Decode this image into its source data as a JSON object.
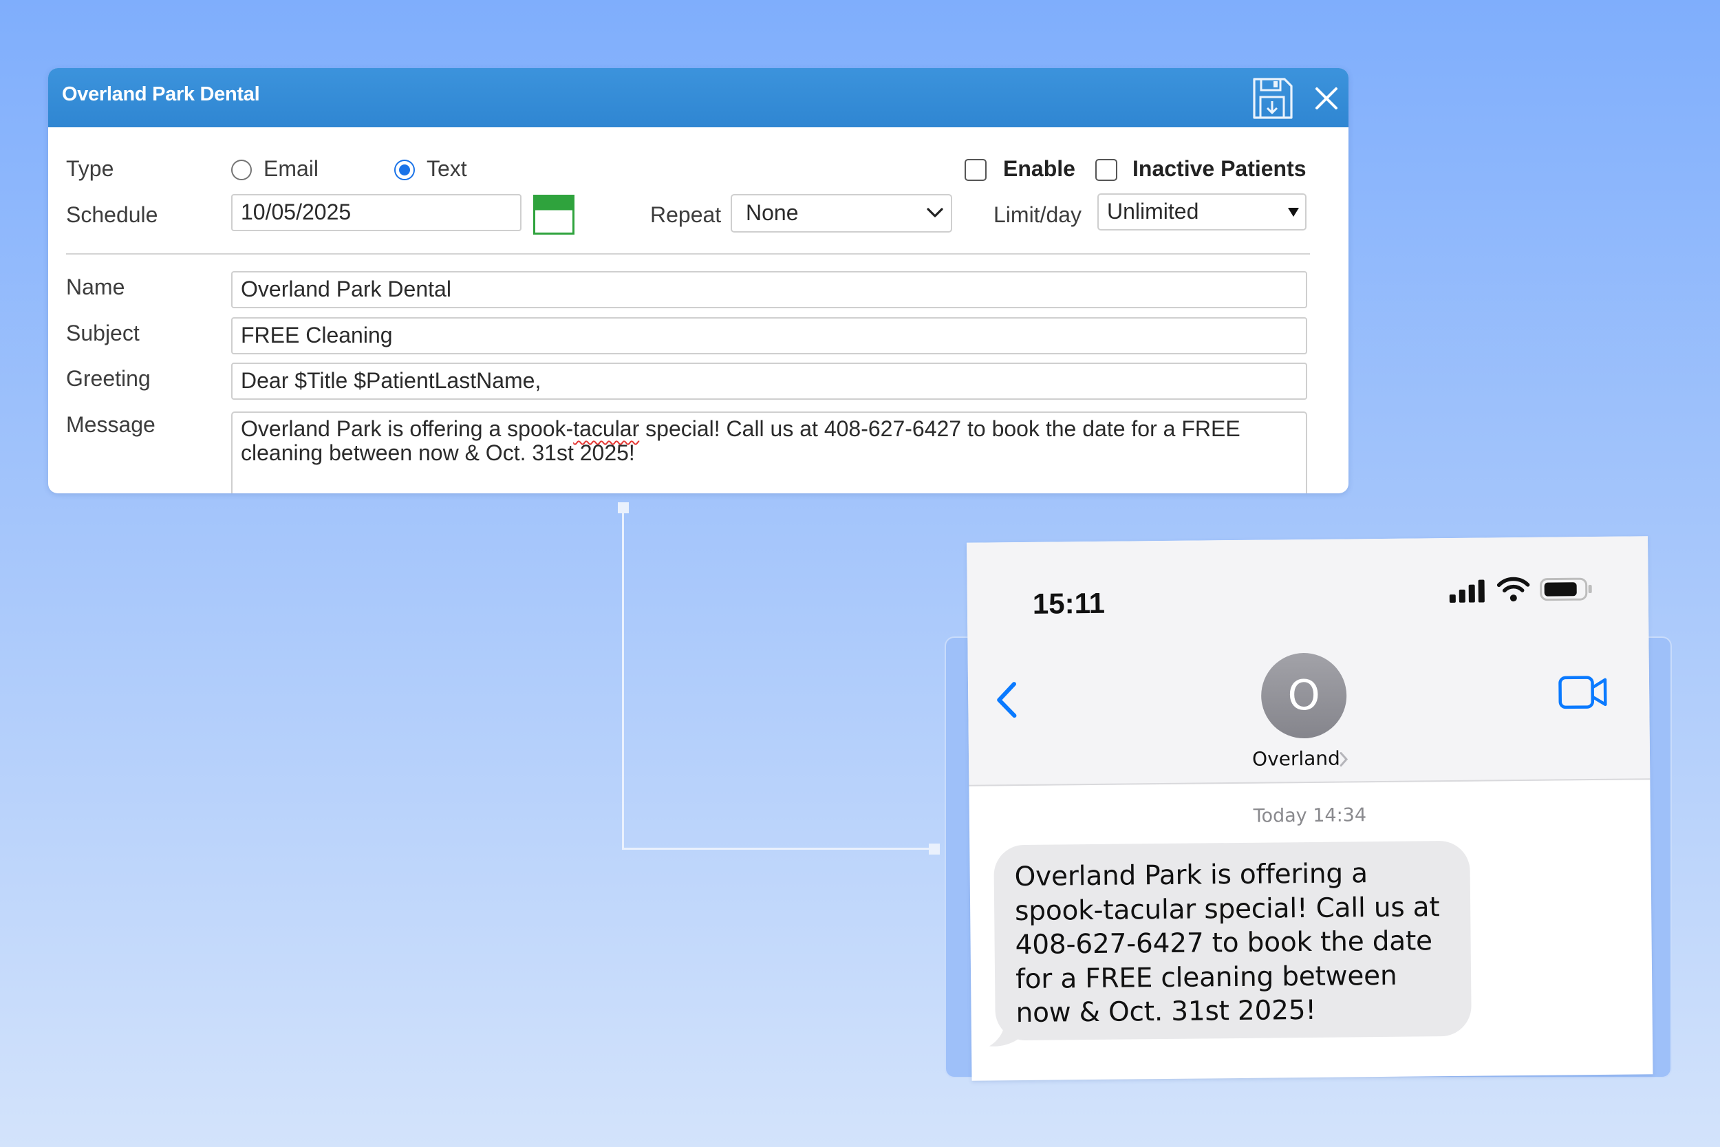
{
  "dialog": {
    "title": "Overland Park Dental",
    "labels": {
      "type": "Type",
      "schedule": "Schedule",
      "name": "Name",
      "subject": "Subject",
      "greeting": "Greeting",
      "message": "Message",
      "repeat": "Repeat",
      "limit": "Limit/day"
    },
    "type_options": {
      "email": "Email",
      "text": "Text",
      "selected": "Text"
    },
    "enable_label": "Enable",
    "inactive_label": "Inactive Patients",
    "schedule_date": "10/05/2025",
    "repeat_value": "None",
    "limit_value": "Unlimited",
    "name_value": "Overland Park Dental",
    "subject_value": "FREE Cleaning",
    "greeting_value": "Dear $Title $PatientLastName,",
    "message_parts": {
      "before": "Overland Park is offering a spook-",
      "misspelled": "tacular",
      "after": " special! Call us at 408-627-6427 to book the date for a FREE cleaning between now & Oct. 31st 2025!"
    },
    "colors": {
      "titlebar": "#2f86d2",
      "accent": "#1a73e8"
    }
  },
  "phone": {
    "time": "15:11",
    "avatar_initial": "O",
    "contact_name": "Overland",
    "message_time": "Today 14:34",
    "message_lines": [
      "Overland Park is offering a",
      "spook-tacular special! Call us at",
      "408-627-6427 to book the date",
      "for a FREE cleaning between",
      "now & Oct. 31st 2025!"
    ],
    "colors": {
      "ios_blue": "#0a7aff",
      "bubble": "#e9e9eb"
    }
  }
}
